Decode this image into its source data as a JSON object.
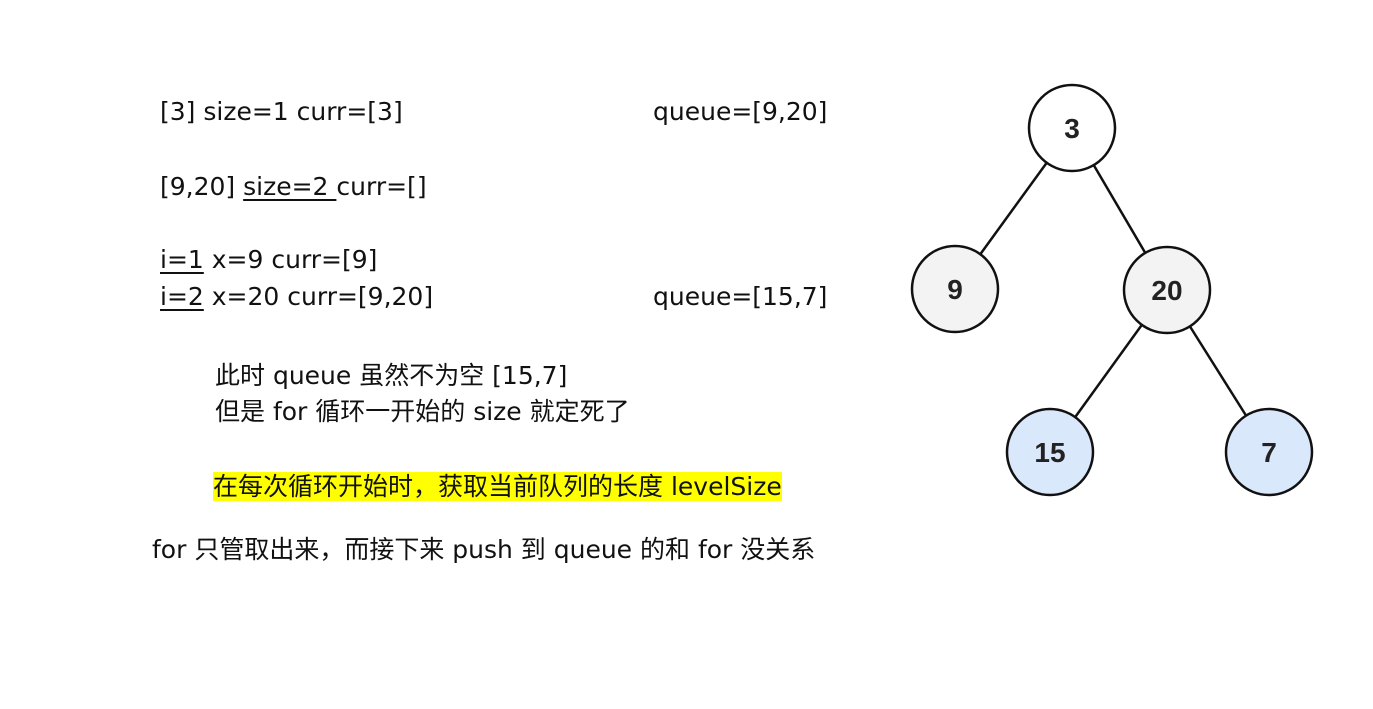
{
  "lines": {
    "l1": {
      "a": "[3] size=1 curr=[3]",
      "queue": "queue=[9,20]"
    },
    "l2": {
      "a": "[9,20] ",
      "b": "size=2 ",
      "c": "curr=[]"
    },
    "l3": {
      "i": "i=1",
      "rest": " x=9 curr=[9]"
    },
    "l4": {
      "i": "i=2",
      "rest": " x=20 curr=[9,20]",
      "queue": "queue=[15,7]"
    }
  },
  "notes": {
    "n1": "此时 queue 虽然不为空 [15,7]",
    "n2": "但是 for 循环一开始的 size 就定死了",
    "highlight": "在每次循环开始时，获取当前队列的长度 levelSize",
    "footer": "for 只管取出来，而接下来 push 到 queue 的和 for 没关系"
  },
  "tree": {
    "nodes": [
      {
        "id": "n3",
        "label": "3",
        "fill": "#ffffff"
      },
      {
        "id": "n9",
        "label": "9",
        "fill": "#f3f3f3"
      },
      {
        "id": "n20",
        "label": "20",
        "fill": "#f3f3f3"
      },
      {
        "id": "n15",
        "label": "15",
        "fill": "#dae8fc"
      },
      {
        "id": "n7",
        "label": "7",
        "fill": "#dae8fc"
      }
    ],
    "edges": [
      [
        "n3",
        "n9"
      ],
      [
        "n3",
        "n20"
      ],
      [
        "n20",
        "n15"
      ],
      [
        "n20",
        "n7"
      ]
    ]
  }
}
